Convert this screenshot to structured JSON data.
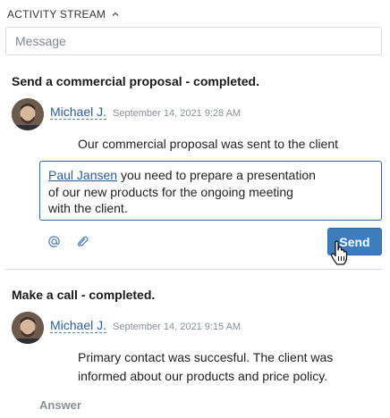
{
  "header": {
    "title": "ACTIVITY STREAM"
  },
  "composer": {
    "placeholder": "Message"
  },
  "activities": [
    {
      "title": "Send a commercial proposal - completed.",
      "author": "Michael J.",
      "timestamp": "September 14, 2021 9:28 AM",
      "comment": "Our commercial proposal was sent to the client"
    },
    {
      "title": "Make a call - completed.",
      "author": "Michael J.",
      "timestamp": "September 14, 2021 9:15 AM",
      "comment_line1": "Primary contact was succesful. The client was",
      "comment_line2": "informed about our products and price policy."
    }
  ],
  "reply": {
    "mention": "Paul Jansen",
    "line1_rest": " you need to prepare a presentation",
    "line2": "of our new products for the ongoing meeting",
    "line3": "with the client."
  },
  "toolbar": {
    "mention_icon": "at-icon",
    "attach_icon": "paperclip-icon",
    "send_label": "Send"
  },
  "answer_label": "Answer",
  "colors": {
    "accent": "#3d7dbd",
    "link": "#2c5d8f",
    "focus_border": "#2f6799"
  }
}
